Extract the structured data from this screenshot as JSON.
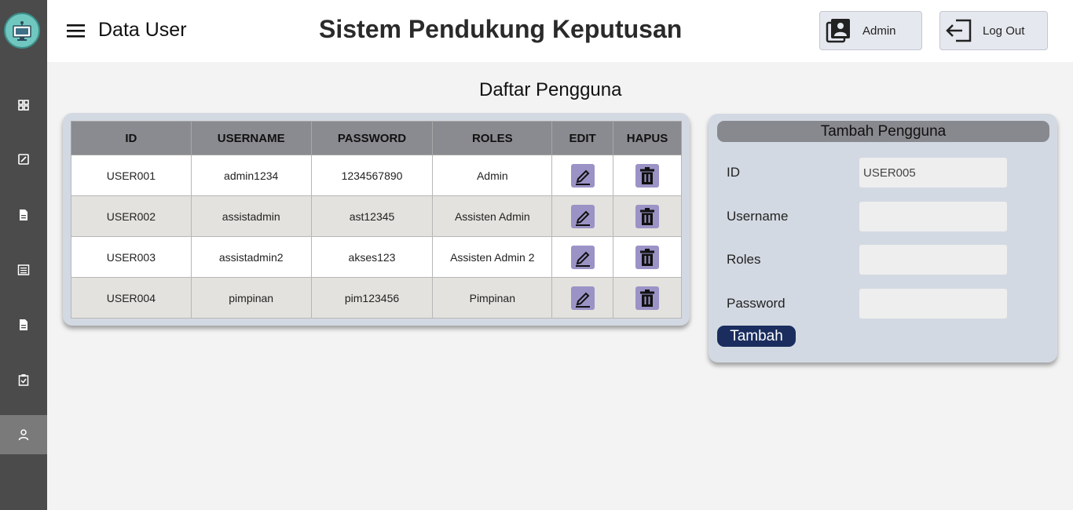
{
  "header": {
    "page_title": "Data User",
    "app_title": "Sistem Pendukung Keputusan",
    "admin_label": "Admin",
    "logout_label": "Log Out"
  },
  "main": {
    "section_title": "Daftar Pengguna",
    "columns": [
      "ID",
      "USERNAME",
      "PASSWORD",
      "ROLES",
      "EDIT",
      "HAPUS"
    ],
    "rows": [
      {
        "id": "USER001",
        "username": "admin1234",
        "password": "1234567890",
        "roles": "Admin"
      },
      {
        "id": "USER002",
        "username": "assistadmin",
        "password": "ast12345",
        "roles": "Assisten Admin"
      },
      {
        "id": "USER003",
        "username": "assistadmin2",
        "password": "akses123",
        "roles": "Assisten Admin 2"
      },
      {
        "id": "USER004",
        "username": "pimpinan",
        "password": "pim123456",
        "roles": "Pimpinan"
      }
    ]
  },
  "form": {
    "title": "Tambah Pengguna",
    "id_label": "ID",
    "id_value": "USER005",
    "username_label": "Username",
    "username_value": "",
    "roles_label": "Roles",
    "roles_value": "",
    "password_label": "Password",
    "password_value": "",
    "submit_label": "Tambah"
  },
  "sidebar": {
    "items": [
      {
        "icon": "dashboard-icon"
      },
      {
        "icon": "edit-square-icon"
      },
      {
        "icon": "document-icon"
      },
      {
        "icon": "list-icon"
      },
      {
        "icon": "document-icon"
      },
      {
        "icon": "clipboard-check-icon"
      },
      {
        "icon": "user-icon",
        "active": true
      }
    ]
  },
  "colors": {
    "sidebar": "#4b4b4b",
    "sidebar_active": "#7a7a7a",
    "table_header": "#8a8b90",
    "row_alt": "#e3e2de",
    "action_icon_bg": "#9b93c6",
    "primary_button": "#1a2d5e",
    "card_bg": "#d3d9e2"
  }
}
